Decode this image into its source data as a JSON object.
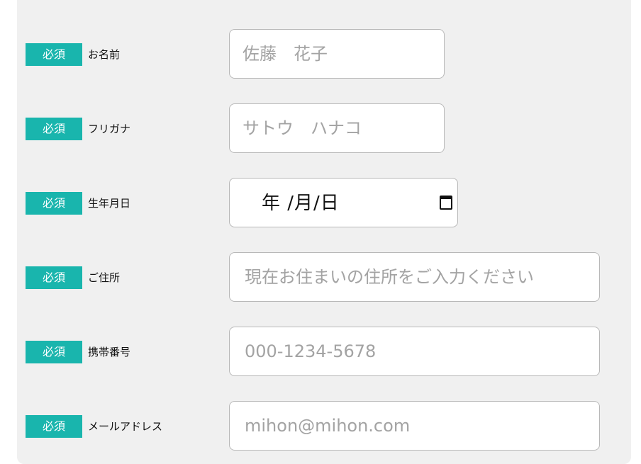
{
  "form": {
    "required_badge": "必須",
    "rows": [
      {
        "label": "お名前",
        "placeholder": "佐藤　花子"
      },
      {
        "label": "フリガナ",
        "placeholder": "サトウ　ハナコ"
      },
      {
        "label": "生年月日",
        "date_display": "年 /月/日"
      },
      {
        "label": "ご住所",
        "placeholder": "現在お住まいの住所をご入力ください"
      },
      {
        "label": "携帯番号",
        "placeholder": "000-1234-5678"
      },
      {
        "label": "メールアドレス",
        "placeholder": "mihon@mihon.com"
      }
    ]
  },
  "colors": {
    "badge": "#19b5ad",
    "panel": "#f0f0f0",
    "placeholder": "#a3a3a3"
  },
  "icons": {
    "date_picker": "calendar-icon"
  }
}
